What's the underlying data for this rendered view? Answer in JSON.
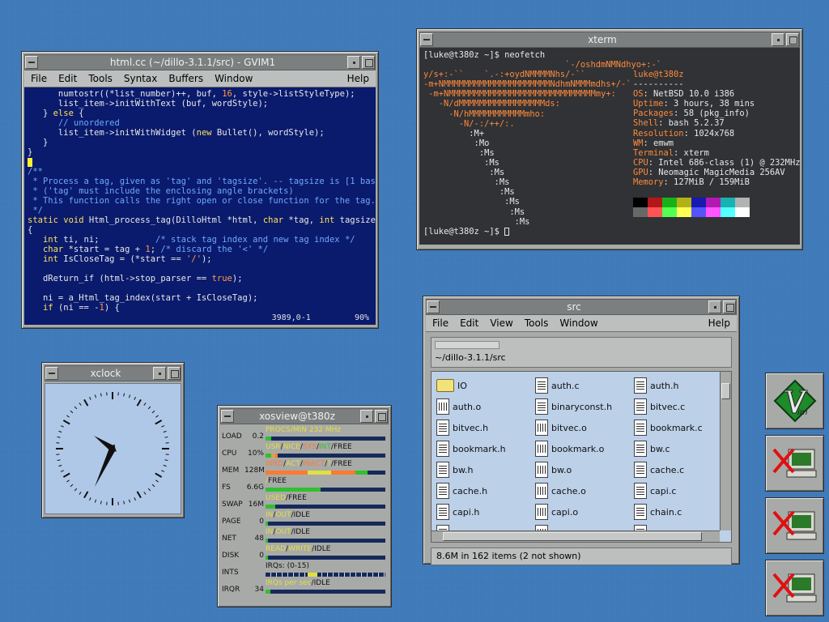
{
  "gvim": {
    "title": "html.cc (~/dillo-3.1.1/src) - GVIM1",
    "menu": [
      "File",
      "Edit",
      "Tools",
      "Syntax",
      "Buffers",
      "Window"
    ],
    "help": "Help",
    "position": "3989,0-1",
    "percent": "90%"
  },
  "xterm": {
    "title": "xterm",
    "prompt1": "[luke@t380z ~]$ neofetch",
    "userhost": "luke@t380z",
    "sep": "----------",
    "info": [
      {
        "k": "OS",
        "v": "NetBSD 10.0 i386"
      },
      {
        "k": "Uptime",
        "v": "3 hours, 38 mins"
      },
      {
        "k": "Packages",
        "v": "58 (pkg_info)"
      },
      {
        "k": "Shell",
        "v": "bash 5.2.37"
      },
      {
        "k": "Resolution",
        "v": "1024x768"
      },
      {
        "k": "WM",
        "v": "emwm"
      },
      {
        "k": "Terminal",
        "v": "xterm"
      },
      {
        "k": "CPU",
        "v": "Intel 686-class (1) @ 232MHz"
      },
      {
        "k": "GPU",
        "v": "Neomagic MagicMedia 256AV"
      },
      {
        "k": "Memory",
        "v": "127MiB / 159MiB"
      }
    ],
    "prompt2": "[luke@t380z ~]$ ",
    "palette": [
      "#000000",
      "#b21818",
      "#18b218",
      "#b2b218",
      "#1818b2",
      "#b218b2",
      "#18b2b2",
      "#b2b2b2",
      "#686868",
      "#ff5454",
      "#54ff54",
      "#ffff54",
      "#5454ff",
      "#ff54ff",
      "#54ffff",
      "#ffffff"
    ]
  },
  "xclock": {
    "title": "xclock"
  },
  "xosview": {
    "title": "xosview@t380z",
    "rows": [
      {
        "label": "LOAD",
        "val": "0.2",
        "caps": [
          [
            "PROCS/MIN",
            "#e0e040"
          ],
          [
            "  232 MHz",
            "#e0e040"
          ]
        ],
        "segs": [
          [
            "#30c030",
            0.05
          ]
        ]
      },
      {
        "label": "CPU",
        "val": "10%",
        "caps": [
          [
            "USR",
            "#e0e040"
          ],
          [
            "/",
            "#101010"
          ],
          [
            "NICE",
            "#e0e040"
          ],
          [
            "/",
            "#101010"
          ],
          [
            "SYS",
            "#ff7a30"
          ],
          [
            "/",
            "#101010"
          ],
          [
            "INT",
            "#3cb83c"
          ],
          [
            "/",
            "#101010"
          ],
          [
            "FREE",
            "#101010"
          ]
        ],
        "segs": [
          [
            "#30c030",
            0.05
          ],
          [
            "#e0a040",
            0.03
          ],
          [
            "#ff7a30",
            0.02
          ]
        ]
      },
      {
        "label": "MEM",
        "val": "128M",
        "caps": [
          [
            "WRD",
            "#ff7a30"
          ],
          [
            "/",
            "#101010"
          ],
          [
            "ACT",
            "#e0e040"
          ],
          [
            "/",
            "#101010"
          ],
          [
            "INACT",
            "#ff7a30"
          ],
          [
            "/",
            "#101010"
          ],
          [
            "?",
            "#e0e040"
          ],
          [
            "/",
            "#101010"
          ],
          [
            "FREE",
            "#101010"
          ]
        ],
        "segs": [
          [
            "#ff7a30",
            0.35
          ],
          [
            "#e0e040",
            0.2
          ],
          [
            "#ff7a30",
            0.2
          ],
          [
            "#30c030",
            0.1
          ]
        ]
      },
      {
        "label": "FS",
        "val": "6.6G",
        "caps": [
          [
            "/",
            "#e0e040"
          ],
          [
            "FREE",
            "#101010"
          ]
        ],
        "segs": [
          [
            "#30c030",
            0.46
          ]
        ]
      },
      {
        "label": "SWAP",
        "val": "16M",
        "caps": [
          [
            "USED",
            "#e0e040"
          ],
          [
            "/",
            "#101010"
          ],
          [
            "FREE",
            "#101010"
          ]
        ],
        "segs": [
          [
            "#30c030",
            0.08
          ]
        ]
      },
      {
        "label": "PAGE",
        "val": "0",
        "caps": [
          [
            "IN",
            "#e0e040"
          ],
          [
            "/",
            "#101010"
          ],
          [
            "OUT",
            "#e0e040"
          ],
          [
            "/",
            "#101010"
          ],
          [
            "IDLE",
            "#101010"
          ]
        ],
        "segs": [
          [
            "#30c030",
            0.02
          ]
        ]
      },
      {
        "label": "NET",
        "val": "48",
        "caps": [
          [
            "IN",
            "#e0e040"
          ],
          [
            "/",
            "#101010"
          ],
          [
            "OUT",
            "#e0e040"
          ],
          [
            "/",
            "#101010"
          ],
          [
            "IDLE",
            "#101010"
          ]
        ],
        "segs": [
          [
            "#30c030",
            0.02
          ]
        ]
      },
      {
        "label": "DISK",
        "val": "0",
        "caps": [
          [
            "READ",
            "#e0e040"
          ],
          [
            "/",
            "#101010"
          ],
          [
            "WRITE",
            "#e0e040"
          ],
          [
            "/",
            "#101010"
          ],
          [
            "IDLE",
            "#101010"
          ]
        ],
        "segs": [
          [
            "#30c030",
            0.02
          ]
        ]
      },
      {
        "label": "INTS",
        "val": "",
        "caps": [
          [
            "IRQs: (0-15)",
            "#101010"
          ]
        ],
        "segs": []
      },
      {
        "label": "IRQR",
        "val": "34",
        "caps": [
          [
            "IRQs per sec",
            "#e0e040"
          ],
          [
            "/",
            "#101010"
          ],
          [
            "IDLE",
            "#101010"
          ]
        ],
        "segs": [
          [
            "#30c030",
            0.04
          ]
        ]
      }
    ]
  },
  "src": {
    "title": "src",
    "menu": [
      "File",
      "Edit",
      "View",
      "Tools",
      "Window"
    ],
    "help": "Help",
    "path": "~/dillo-3.1.1/src",
    "files": [
      {
        "n": "IO",
        "t": "folder"
      },
      {
        "n": "auth.c",
        "t": "doc"
      },
      {
        "n": "auth.h",
        "t": "doc"
      },
      {
        "n": "auth.o",
        "t": "bin"
      },
      {
        "n": "binaryconst.h",
        "t": "doc"
      },
      {
        "n": "bitvec.c",
        "t": "doc"
      },
      {
        "n": "bitvec.h",
        "t": "doc"
      },
      {
        "n": "bitvec.o",
        "t": "bin"
      },
      {
        "n": "bookmark.c",
        "t": "doc"
      },
      {
        "n": "bookmark.h",
        "t": "doc"
      },
      {
        "n": "bookmark.o",
        "t": "bin"
      },
      {
        "n": "bw.c",
        "t": "doc"
      },
      {
        "n": "bw.h",
        "t": "doc"
      },
      {
        "n": "bw.o",
        "t": "bin"
      },
      {
        "n": "cache.c",
        "t": "doc"
      },
      {
        "n": "cache.h",
        "t": "doc"
      },
      {
        "n": "cache.o",
        "t": "bin"
      },
      {
        "n": "capi.c",
        "t": "doc"
      },
      {
        "n": "capi.h",
        "t": "doc"
      },
      {
        "n": "capi.o",
        "t": "bin"
      },
      {
        "n": "chain.c",
        "t": "doc"
      },
      {
        "n": "",
        "t": "doc"
      },
      {
        "n": "",
        "t": "bin"
      },
      {
        "n": "",
        "t": "doc"
      }
    ],
    "status": "8.6M in 162 items (2 not shown)"
  },
  "dock": [
    {
      "name": "vim-dock-icon"
    },
    {
      "name": "xterm-dock-icon"
    },
    {
      "name": "xterm-dock-icon"
    },
    {
      "name": "xterm-dock-icon"
    }
  ]
}
